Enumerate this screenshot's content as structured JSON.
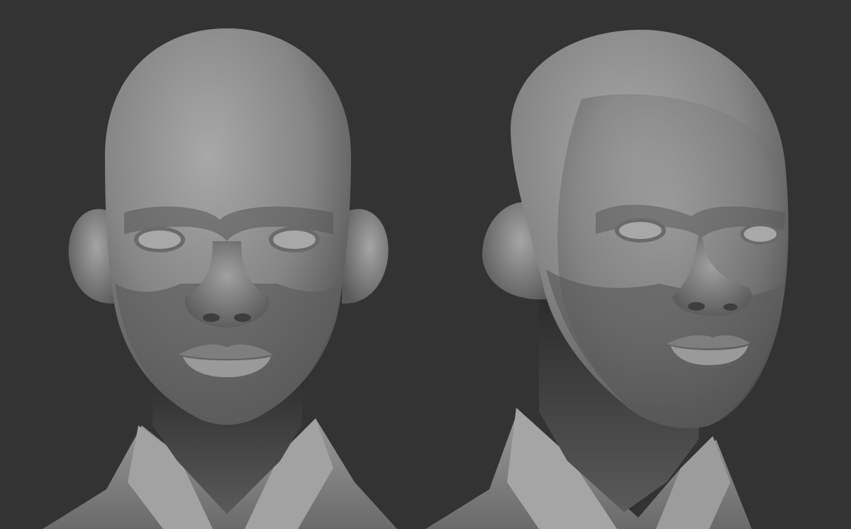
{
  "scene": {
    "background_color": "#333333",
    "clay_color": "#8a8a8a",
    "subjects": [
      {
        "id": "front",
        "view": "front",
        "icon": "sculpt-head-front"
      },
      {
        "id": "three-quarter",
        "view": "three-quarter",
        "icon": "sculpt-head-three-quarter"
      }
    ]
  }
}
